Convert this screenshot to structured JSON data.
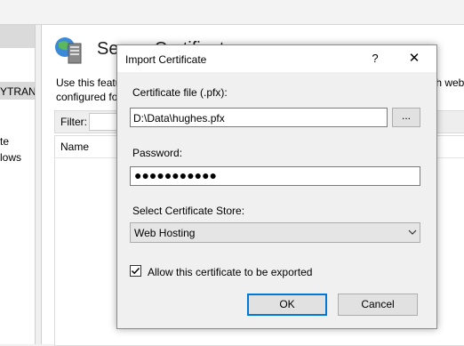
{
  "background": {
    "main_title": "Server Certificates",
    "description_left": "Use this featu",
    "description_left_line2": "configured fo",
    "description_right": "th web",
    "filter_label": "Filter:",
    "list_column_name": "Name",
    "left_pane_items": [
      "YTRANS",
      "te",
      "lows"
    ]
  },
  "dialog": {
    "title": "Import Certificate",
    "help_glyph": "?",
    "close_glyph": "✕",
    "cert_file_label": "Certificate file (.pfx):",
    "cert_file_value": "D:\\Data\\hughes.pfx",
    "browse_label": "...",
    "password_label": "Password:",
    "password_masked": "●●●●●●●●●●●",
    "store_label": "Select Certificate Store:",
    "store_value": "Web Hosting",
    "exportable_label": "Allow this certificate to be exported",
    "exportable_checked": true,
    "ok_label": "OK",
    "cancel_label": "Cancel"
  },
  "colors": {
    "accent": "#0078d7",
    "dialog_bg": "#f0f0f0"
  }
}
